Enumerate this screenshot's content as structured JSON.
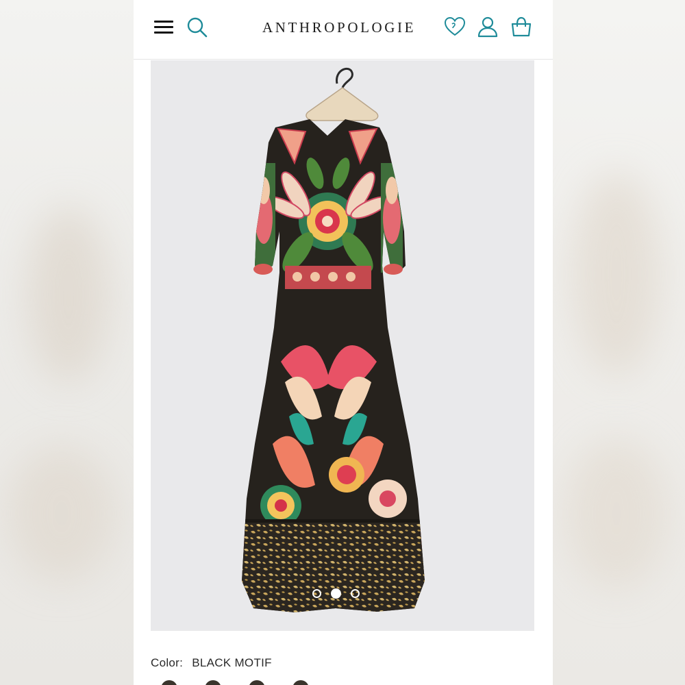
{
  "header": {
    "brand": "ANTHROPOLOGIE",
    "icons": [
      "menu-icon",
      "search-icon",
      "heart-icon",
      "user-icon",
      "bag-icon"
    ],
    "accent_color": "#1e8b99"
  },
  "product": {
    "image_alt": "Printed maxi dress on hanger",
    "carousel": {
      "total": 3,
      "active_index": 2
    },
    "color_label": "Color:",
    "color_value": "BLACK MOTIF"
  }
}
